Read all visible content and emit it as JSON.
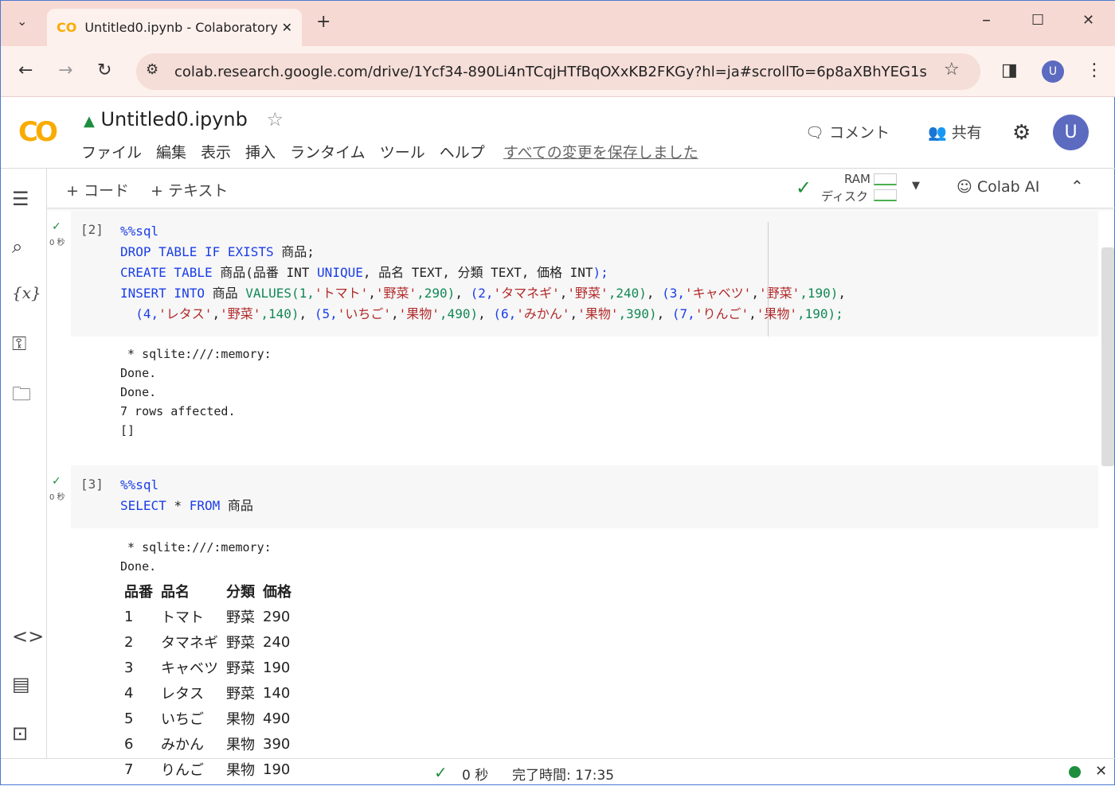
{
  "browser": {
    "tab_title": "Untitled0.ipynb - Colaboratory",
    "url": "colab.research.google.com/drive/1Ycf34-890Li4nTCqjHTfBqOXxKB2FKGy?hl=ja#scrollTo=6p8aXBhYEG1s",
    "profile": "U"
  },
  "header": {
    "notebook_title": "Untitled0.ipynb",
    "menu": [
      "ファイル",
      "編集",
      "表示",
      "挿入",
      "ランタイム",
      "ツール",
      "ヘルプ"
    ],
    "save_status": "すべての変更を保存しました",
    "comment": "コメント",
    "share": "共有",
    "avatar": "U",
    "brand_color": "#f9ab00"
  },
  "toolbar": {
    "add_code": "+ コード",
    "add_text": "+ テキスト",
    "ram": "RAM",
    "disk": "ディスク",
    "colab_ai": "Colab AI"
  },
  "cells": [
    {
      "count": "[2]",
      "time": "0 秒",
      "code": [
        [
          [
            "%%sql",
            "kw"
          ]
        ],
        [
          [
            "DROP TABLE IF EXISTS ",
            "kw"
          ],
          [
            "商品;",
            "pl"
          ]
        ],
        [
          [
            "CREATE TABLE ",
            "kw"
          ],
          [
            "商品(品番 INT ",
            "pl"
          ],
          [
            "UNIQUE",
            "kw"
          ],
          [
            ", 品名 TEXT, 分類 TEXT, 価格 INT",
            "pl"
          ],
          [
            ");",
            "kw"
          ]
        ],
        [
          [
            "INSERT INTO ",
            "kw"
          ],
          [
            "商品 ",
            "pl"
          ],
          [
            "VALUES(1,",
            "gr"
          ],
          [
            "'トマト'",
            "str"
          ],
          [
            ",",
            "pl"
          ],
          [
            "'野菜'",
            "str"
          ],
          [
            ",290)",
            "num"
          ],
          [
            ", ",
            "pl"
          ],
          [
            "(2,",
            "kw"
          ],
          [
            "'タマネギ'",
            "str"
          ],
          [
            ",",
            "pl"
          ],
          [
            "'野菜'",
            "str"
          ],
          [
            ",240)",
            "num"
          ],
          [
            ", ",
            "pl"
          ],
          [
            "(3,",
            "kw"
          ],
          [
            "'キャベツ'",
            "str"
          ],
          [
            ",",
            "pl"
          ],
          [
            "'野菜'",
            "str"
          ],
          [
            ",190)",
            "num"
          ],
          [
            ",",
            "pl"
          ]
        ],
        [
          [
            "  (4,",
            "kw"
          ],
          [
            "'レタス'",
            "str"
          ],
          [
            ",",
            "pl"
          ],
          [
            "'野菜'",
            "str"
          ],
          [
            ",140)",
            "num"
          ],
          [
            ", ",
            "pl"
          ],
          [
            "(5,",
            "kw"
          ],
          [
            "'いちご'",
            "str"
          ],
          [
            ",",
            "pl"
          ],
          [
            "'果物'",
            "str"
          ],
          [
            ",490)",
            "num"
          ],
          [
            ", ",
            "pl"
          ],
          [
            "(6,",
            "kw"
          ],
          [
            "'みかん'",
            "str"
          ],
          [
            ",",
            "pl"
          ],
          [
            "'果物'",
            "str"
          ],
          [
            ",390)",
            "num"
          ],
          [
            ", ",
            "pl"
          ],
          [
            "(7,",
            "kw"
          ],
          [
            "'りんご'",
            "str"
          ],
          [
            ",",
            "pl"
          ],
          [
            "'果物'",
            "str"
          ],
          [
            ",190);",
            "num"
          ]
        ]
      ],
      "output": " * sqlite:///:memory:\nDone.\nDone.\n7 rows affected.\n[]"
    },
    {
      "count": "[3]",
      "time": "0 秒",
      "code": [
        [
          [
            "%%sql",
            "kw"
          ]
        ],
        [
          [
            "SELECT ",
            "kw"
          ],
          [
            "* ",
            "pl"
          ],
          [
            "FROM ",
            "kw"
          ],
          [
            "商品",
            "pl"
          ]
        ]
      ],
      "output": " * sqlite:///:memory:\nDone."
    }
  ],
  "result_table": {
    "headers": [
      "品番",
      "品名",
      "分類",
      "価格"
    ],
    "rows": [
      [
        "1",
        "トマト",
        "野菜",
        "290"
      ],
      [
        "2",
        "タマネギ",
        "野菜",
        "240"
      ],
      [
        "3",
        "キャベツ",
        "野菜",
        "190"
      ],
      [
        "4",
        "レタス",
        "野菜",
        "140"
      ],
      [
        "5",
        "いちご",
        "果物",
        "490"
      ],
      [
        "6",
        "みかん",
        "果物",
        "390"
      ],
      [
        "7",
        "りんご",
        "果物",
        "190"
      ]
    ]
  },
  "status": {
    "elapsed": "0 秒",
    "completed": "完了時間: 17:35"
  }
}
